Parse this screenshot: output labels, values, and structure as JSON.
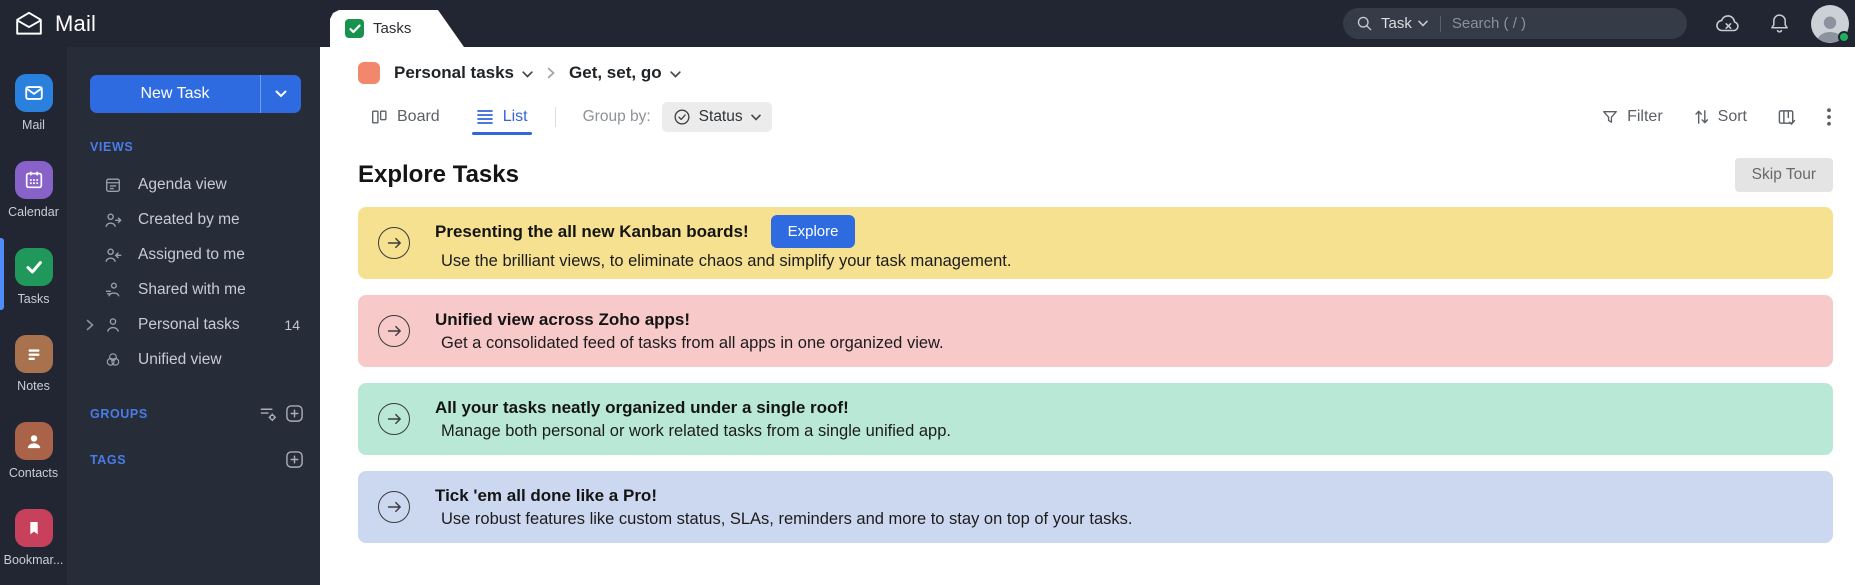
{
  "topbar": {
    "app_name": "Mail",
    "tab_label": "Tasks",
    "search_scope": "Task",
    "search_placeholder": "Search ( / )"
  },
  "rail": {
    "items": [
      {
        "label": "Mail",
        "icon": "mail-icon",
        "color": "#2a81dd",
        "active": false
      },
      {
        "label": "Calendar",
        "icon": "calendar-icon",
        "color": "#8861c9",
        "active": false
      },
      {
        "label": "Tasks",
        "icon": "tasks-check-icon",
        "color": "#21985b",
        "active": true
      },
      {
        "label": "Notes",
        "icon": "notes-icon",
        "color": "#a9724f",
        "active": false
      },
      {
        "label": "Contacts",
        "icon": "contacts-icon",
        "color": "#aa6248",
        "active": false
      },
      {
        "label": "Bookmar...",
        "icon": "bookmark-icon",
        "color": "#c8415c",
        "active": false
      }
    ]
  },
  "sidebar": {
    "new_task_label": "New Task",
    "views_header": "VIEWS",
    "views": [
      {
        "label": "Agenda view",
        "icon": "agenda-icon"
      },
      {
        "label": "Created by me",
        "icon": "person-arrow-out-icon"
      },
      {
        "label": "Assigned to me",
        "icon": "person-arrow-in-icon"
      },
      {
        "label": "Shared with me",
        "icon": "person-share-icon"
      },
      {
        "label": "Personal tasks",
        "icon": "person-icon",
        "count": "14",
        "expandable": true
      },
      {
        "label": "Unified view",
        "icon": "venn-circles-icon"
      }
    ],
    "groups_header": "GROUPS",
    "tags_header": "TAGS"
  },
  "main": {
    "breadcrumb": {
      "list_name": "Personal tasks",
      "page_name": "Get, set, go",
      "swatch_color": "#f2876c"
    },
    "toolbar": {
      "board_label": "Board",
      "list_label": "List",
      "group_by_label": "Group by:",
      "group_by_value": "Status",
      "filter_label": "Filter",
      "sort_label": "Sort"
    },
    "heading": "Explore Tasks",
    "skip_tour_label": "Skip Tour",
    "banners": [
      {
        "title": "Presenting the all new Kanban boards!",
        "subtitle": "Use the brilliant views, to eliminate chaos and simplify your task management.",
        "cta": "Explore",
        "bg": "#f6e190"
      },
      {
        "title": "Unified view across Zoho apps!",
        "subtitle": "Get a consolidated feed of tasks from all apps in one organized view.",
        "bg": "#f8c9c9"
      },
      {
        "title": "All your tasks neatly organized under a single roof!",
        "subtitle": "Manage both personal or work related tasks from a single unified app.",
        "bg": "#b9e8d7"
      },
      {
        "title": "Tick 'em all done like a Pro!",
        "subtitle": "Use robust features like custom status, SLAs, reminders and more to stay on top of your tasks.",
        "bg": "#ccd8f0"
      }
    ]
  },
  "colors": {
    "topbar_bg": "#212632",
    "sidebar_bg": "#272c39",
    "accent_blue": "#2e6be0",
    "active_tab_blue": "#3367d6",
    "section_header_blue": "#4a7ce6",
    "tab_check_green": "#17934f",
    "presence_green": "#1fb15c"
  }
}
